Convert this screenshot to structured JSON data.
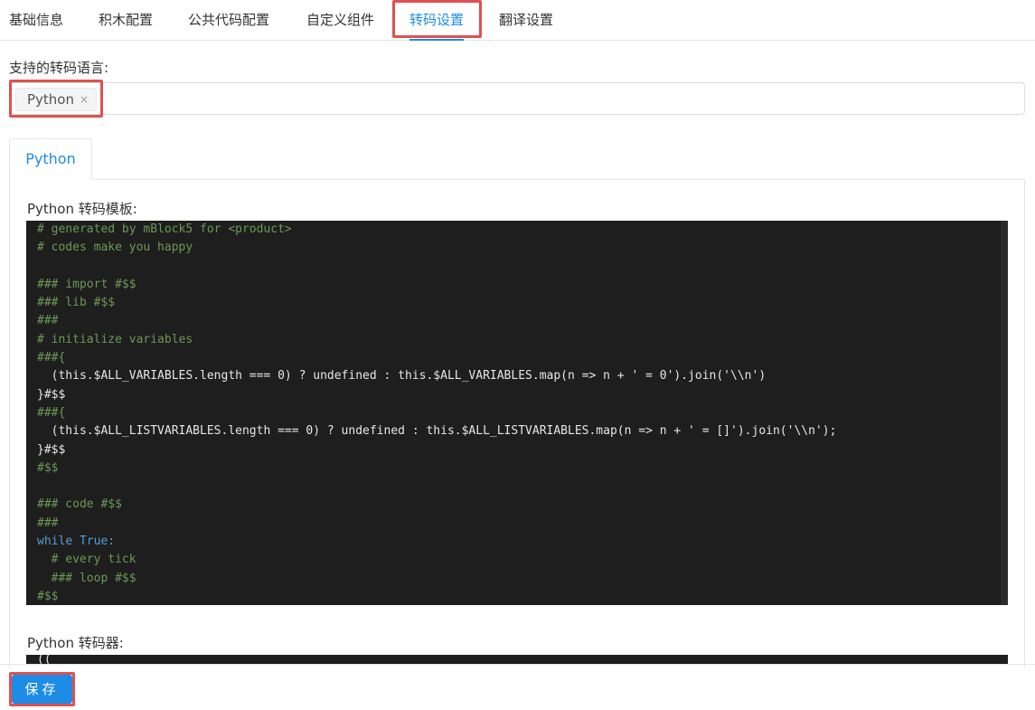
{
  "top_tabs": [
    {
      "label": "基础信息"
    },
    {
      "label": "积木配置"
    },
    {
      "label": "公共代码配置"
    },
    {
      "label": "自定义组件"
    },
    {
      "label": "转码设置",
      "active": true
    },
    {
      "label": "翻译设置"
    }
  ],
  "supported_languages": {
    "label": "支持的转码语言:",
    "selected_tags": [
      "Python"
    ],
    "tag_remove_icon": "×"
  },
  "language_tabs": [
    {
      "label": "Python",
      "active": true
    }
  ],
  "template_section": {
    "label": "Python 转码模板:",
    "code_lines": [
      "# generated by mBlock5 for <product>",
      "# codes make you happy",
      "",
      "### import #$$",
      "### lib #$$",
      "###",
      "# initialize variables",
      "###{",
      "  (this.$ALL_VARIABLES.length === 0) ? undefined : this.$ALL_VARIABLES.map(n => n + ' = 0').join('\\\\n')",
      "}#$$",
      "###{",
      "  (this.$ALL_LISTVARIABLES.length === 0) ? undefined : this.$ALL_LISTVARIABLES.map(n => n + ' = []').join('\\\\n');",
      "}#$$",
      "#$$",
      "",
      "### code #$$",
      "###",
      "while True:",
      "  # every tick",
      "  ### loop #$$",
      "#$$"
    ]
  },
  "converter_section": {
    "label": "Python 转码器:",
    "code_lines": [
      "(("
    ]
  },
  "footer": {
    "save_label": "保存"
  },
  "colors": {
    "accent": "#1c8ce6",
    "highlight_box": "#e05050",
    "editor_bg": "#1e1e1e",
    "comment": "#6a9955",
    "keyword": "#569cd6",
    "string": "#ce9178"
  }
}
